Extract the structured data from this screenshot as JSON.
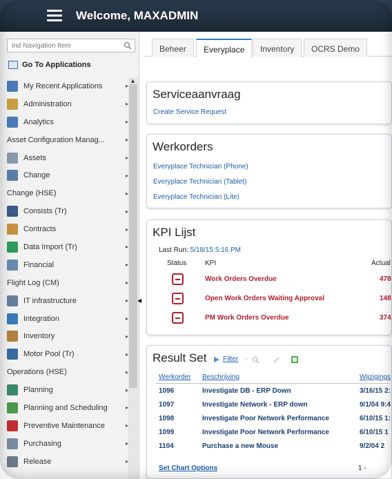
{
  "header": {
    "welcome": "Welcome, MAXADMIN"
  },
  "sidebar": {
    "search_placeholder": "ind Navigation Item",
    "goto_label": "Go To Applications",
    "items": [
      {
        "label": "My Recent Applications",
        "icon": "clock-icon",
        "color": "#4a7bb7"
      },
      {
        "label": "Administration",
        "icon": "admin-icon",
        "color": "#c8a040"
      },
      {
        "label": "Analytics",
        "icon": "analytics-icon",
        "color": "#4a7bb7"
      },
      {
        "label": "Asset Configuration Manag...",
        "icon": "",
        "color": ""
      },
      {
        "label": "Assets",
        "icon": "assets-icon",
        "color": "#8a9aab"
      },
      {
        "label": "Change",
        "icon": "change-icon",
        "color": "#5a7ea8"
      },
      {
        "label": "Change (HSE)",
        "icon": "",
        "color": ""
      },
      {
        "label": "Consists (Tr)",
        "icon": "consists-icon",
        "color": "#3a5a8a"
      },
      {
        "label": "Contracts",
        "icon": "contracts-icon",
        "color": "#c89040"
      },
      {
        "label": "Data Import (Tr)",
        "icon": "data-import-icon",
        "color": "#2e9a5a"
      },
      {
        "label": "Financial",
        "icon": "financial-icon",
        "color": "#6a8ab0"
      },
      {
        "label": "Flight Log (CM)",
        "icon": "",
        "color": ""
      },
      {
        "label": "IT infrastructure",
        "icon": "it-infrastructure-icon",
        "color": "#6a7f9a"
      },
      {
        "label": "Integration",
        "icon": "integration-icon",
        "color": "#3a7ab8"
      },
      {
        "label": "Inventory",
        "icon": "inventory-icon",
        "color": "#b08040"
      },
      {
        "label": "Motor Pool (Tr)",
        "icon": "motor-pool-icon",
        "color": "#3a6aa0"
      },
      {
        "label": "Operations (HSE)",
        "icon": "",
        "color": ""
      },
      {
        "label": "Planning",
        "icon": "planning-icon",
        "color": "#3a8a6a"
      },
      {
        "label": "Planning and Scheduling",
        "icon": "planning-scheduling-icon",
        "color": "#4a9a4a"
      },
      {
        "label": "Preventive Maintenance",
        "icon": "preventive-maintenance-icon",
        "color": "#c03030"
      },
      {
        "label": "Purchasing",
        "icon": "purchasing-icon",
        "color": "#7a8aa0"
      },
      {
        "label": "Release",
        "icon": "release-icon",
        "color": "#6a7a8a"
      }
    ]
  },
  "tabs": [
    "Beheer",
    "Everyplace",
    "Inventory",
    "OCRS Demo"
  ],
  "active_tab": "Everyplace",
  "service": {
    "title": "Serviceaanvraag",
    "link": "Create Service Request"
  },
  "werkorders": {
    "title": "Werkorders",
    "links": [
      "Everyplace Technician (Phone)",
      "Everyplace Technician (Tablet)",
      "Everyplace Technician (Lite)"
    ]
  },
  "kpi": {
    "title": "KPI Lijst",
    "last_run_label": "Last Run:",
    "last_run_value": "5/18/15 5:16 PM",
    "col_status": "Status",
    "col_kpi": "KPI",
    "col_actual": "Actual",
    "rows": [
      {
        "name": "Work Orders Overdue",
        "actual": "478"
      },
      {
        "name": "Open Work Orders Waiting Approval",
        "actual": "148"
      },
      {
        "name": "PM Work Orders Overdue",
        "actual": "374"
      }
    ]
  },
  "resultset": {
    "title": "Result Set",
    "filter": "Filter",
    "col_werkorder": "Werkorder",
    "col_beschrijving": "Beschrijving",
    "col_wijzigings": "Wijzigings",
    "rows": [
      {
        "id": "1096",
        "desc": "Investigate DB - ERP Down",
        "date": "3/16/15 2:"
      },
      {
        "id": "1097",
        "desc": "Investigate Network - ERP down",
        "date": "9/1/04 9:4"
      },
      {
        "id": "1098",
        "desc": "Investigate Poor Network Performance",
        "date": "6/10/15 1:"
      },
      {
        "id": "1099",
        "desc": "Investigate Poor Network Performance",
        "date": "6/10/15 1"
      },
      {
        "id": "1104",
        "desc": "Purchase a new Mouse",
        "date": "9/2/04 2"
      }
    ],
    "footer_link": "Set Chart Options",
    "page_info": "1 -"
  },
  "colors": {
    "header_bg": "#1f2d3b",
    "link": "#1a5ea8",
    "kpi_red": "#b21f2d",
    "tab_accent": "#2e7ac9"
  }
}
